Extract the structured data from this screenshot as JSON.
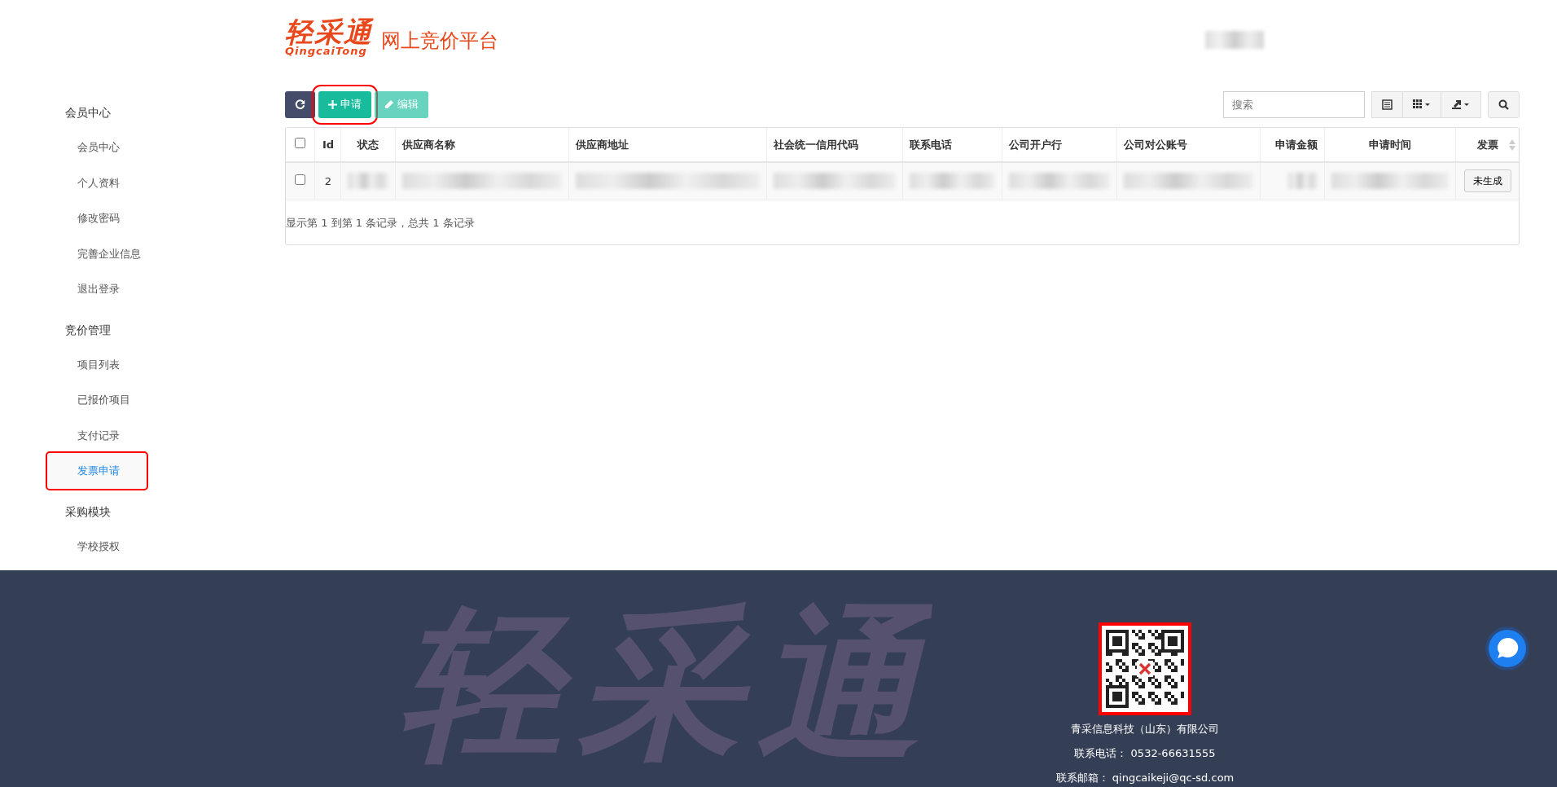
{
  "header": {
    "logo_text": "轻采通",
    "logo_subtext": "QingcaiTong",
    "site_title": "网上竞价平台",
    "user_name_blurred": true
  },
  "sidebar": {
    "groups": [
      {
        "title": "会员中心",
        "items": [
          {
            "label": "会员中心",
            "selected": false,
            "highlighted": false
          },
          {
            "label": "个人资料",
            "selected": false,
            "highlighted": false
          },
          {
            "label": "修改密码",
            "selected": false,
            "highlighted": false
          },
          {
            "label": "完善企业信息",
            "selected": false,
            "highlighted": false
          },
          {
            "label": "退出登录",
            "selected": false,
            "highlighted": false
          }
        ]
      },
      {
        "title": "竞价管理",
        "items": [
          {
            "label": "项目列表",
            "selected": false,
            "highlighted": false
          },
          {
            "label": "已报价项目",
            "selected": false,
            "highlighted": false
          },
          {
            "label": "支付记录",
            "selected": false,
            "highlighted": false
          },
          {
            "label": "发票申请",
            "selected": true,
            "highlighted": true
          }
        ]
      },
      {
        "title": "采购模块",
        "items": [
          {
            "label": "学校授权",
            "selected": false,
            "highlighted": false
          }
        ]
      }
    ]
  },
  "toolbar": {
    "buttons": [
      {
        "kind": "refresh",
        "disabled": false,
        "highlighted": false
      },
      {
        "kind": "add",
        "label": "申请",
        "disabled": false,
        "highlighted": true
      },
      {
        "kind": "edit",
        "label": "编辑",
        "disabled": true,
        "highlighted": false
      }
    ],
    "search": {
      "placeholder": "搜索"
    }
  },
  "table": {
    "select_all_checked": false,
    "columns": [
      {
        "label": "Id"
      },
      {
        "label": "状态"
      },
      {
        "label": "供应商名称"
      },
      {
        "label": "供应商地址"
      },
      {
        "label": "社会统一信用代码"
      },
      {
        "label": "联系电话"
      },
      {
        "label": "公司开户行"
      },
      {
        "label": "公司对公账号"
      },
      {
        "label": "申请金额"
      },
      {
        "label": "申请时间"
      },
      {
        "label": "发票"
      }
    ],
    "rows": [
      {
        "checked": false,
        "cells": [
          {
            "kind": "text",
            "text": "2"
          },
          {
            "kind": "blurred"
          },
          {
            "kind": "blurred"
          },
          {
            "kind": "blurred"
          },
          {
            "kind": "blurred"
          },
          {
            "kind": "blurred"
          },
          {
            "kind": "blurred"
          },
          {
            "kind": "blurred"
          },
          {
            "kind": "blurred"
          },
          {
            "kind": "blurred"
          },
          {
            "kind": "button",
            "text": "未生成"
          }
        ]
      }
    ],
    "summary": "显示第 1 到第 1 条记录，总共 1 条记录"
  },
  "footer": {
    "background_logo": "轻采通",
    "qr_highlighted": true,
    "company": "青采信息科技（山东）有限公司",
    "phone": "联系电话： 0532-66631555",
    "email": "联系邮箱： qingcaikeji@qc-sd.com"
  }
}
